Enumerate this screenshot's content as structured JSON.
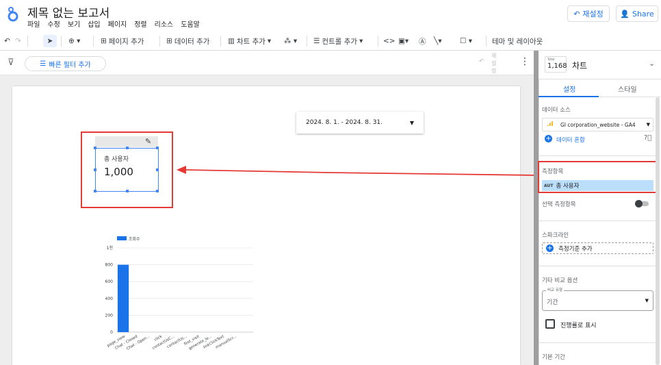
{
  "app": {
    "title": "제목 없는 보고서",
    "menu": [
      "파일",
      "수정",
      "보기",
      "삽입",
      "페이지",
      "정렬",
      "리소스",
      "도움말"
    ],
    "reset_label": "재설정",
    "share_label": "Share"
  },
  "toolbar": {
    "add_page": "페이지 추가",
    "add_data": "데이터 추가",
    "add_chart": "차트 추가",
    "add_control": "컨트롤 추가",
    "theme_layout": "테마 및 레이아웃"
  },
  "filterbar": {
    "quick_filter": "빠른 필터 추가",
    "reset_vertical": "재 설 정"
  },
  "canvas": {
    "date_range": "2024. 8. 1. - 2024. 8. 31.",
    "scorecard": {
      "label": "총 사용자",
      "value": "1,000"
    }
  },
  "chart_data": {
    "type": "bar",
    "legend": [
      "조회수"
    ],
    "series": [
      {
        "name": "조회수",
        "values": [
          800,
          0,
          0,
          0,
          0,
          0,
          0,
          0,
          0,
          0,
          0
        ]
      }
    ],
    "categories": [
      "page_view",
      "Chat - Closed",
      "Chat - Open...",
      "click",
      "contactUsC...",
      "contactUs...",
      "first_visit",
      "generate_le...",
      "linkClickText",
      "manualScr...",
      ""
    ],
    "y_ticks": [
      "0",
      "200",
      "400",
      "600",
      "800",
      "1천"
    ],
    "ylim": [
      0,
      1000
    ],
    "colors": {
      "bar": "#1a73e8"
    }
  },
  "sidebar": {
    "total_small": "Total",
    "total_value": "1,168",
    "panel_title": "차트",
    "tabs": [
      "설정",
      "스타일"
    ],
    "data_source_label": "데이터 소스",
    "data_source_value": "GI corporation_website - GA4",
    "blend_data": "데이터 혼합",
    "metric_label": "측정항목",
    "metric_tag": "AUT",
    "metric_value": "총 사용자",
    "optional_metric": "선택 측정항목",
    "sparkline_label": "스파크라인",
    "add_metric": "측정기준 추가",
    "comparison_label": "기타 비교 옵션",
    "comparison_type_small": "비교 유형",
    "comparison_type_value": "기간",
    "show_progress": "진행률로 표시",
    "default_period": "기본 기간"
  }
}
